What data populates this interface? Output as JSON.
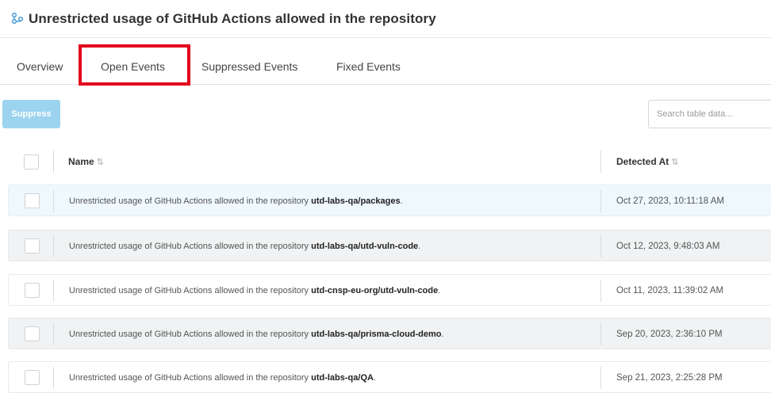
{
  "header": {
    "title": "Unrestricted usage of GitHub Actions allowed in the repository",
    "icon": "policy-icon"
  },
  "tabs": [
    {
      "label": "Overview"
    },
    {
      "label": "Open Events",
      "active": true
    },
    {
      "label": "Suppressed Events"
    },
    {
      "label": "Fixed Events"
    }
  ],
  "toolbar": {
    "suppress_label": "Suppress",
    "search_placeholder": "Search table data..."
  },
  "table": {
    "columns": [
      {
        "label": "Name"
      },
      {
        "label": "Detected At"
      }
    ],
    "rows": [
      {
        "name_prefix": "Unrestricted usage of GitHub Actions allowed in the repository ",
        "repo": "utd-labs-qa/packages",
        "name_suffix": ".",
        "detected_at": "Oct 27, 2023, 10:11:18 AM"
      },
      {
        "name_prefix": "Unrestricted usage of GitHub Actions allowed in the repository ",
        "repo": "utd-labs-qa/utd-vuln-code",
        "name_suffix": ".",
        "detected_at": "Oct 12, 2023, 9:48:03 AM"
      },
      {
        "name_prefix": "Unrestricted usage of GitHub Actions allowed in the repository ",
        "repo": "utd-cnsp-eu-org/utd-vuln-code",
        "name_suffix": ".",
        "detected_at": "Oct 11, 2023, 11:39:02 AM"
      },
      {
        "name_prefix": "Unrestricted usage of GitHub Actions allowed in the repository ",
        "repo": "utd-labs-qa/prisma-cloud-demo",
        "name_suffix": ".",
        "detected_at": "Sep 20, 2023, 2:36:10 PM"
      },
      {
        "name_prefix": "Unrestricted usage of GitHub Actions allowed in the repository ",
        "repo": "utd-labs-qa/QA",
        "name_suffix": ".",
        "detected_at": "Sep 21, 2023, 2:25:28 PM"
      }
    ]
  },
  "colors": {
    "highlight": "#e3001b",
    "suppress_button": "#9cd3ee",
    "selected_row": "#eef8fd"
  }
}
